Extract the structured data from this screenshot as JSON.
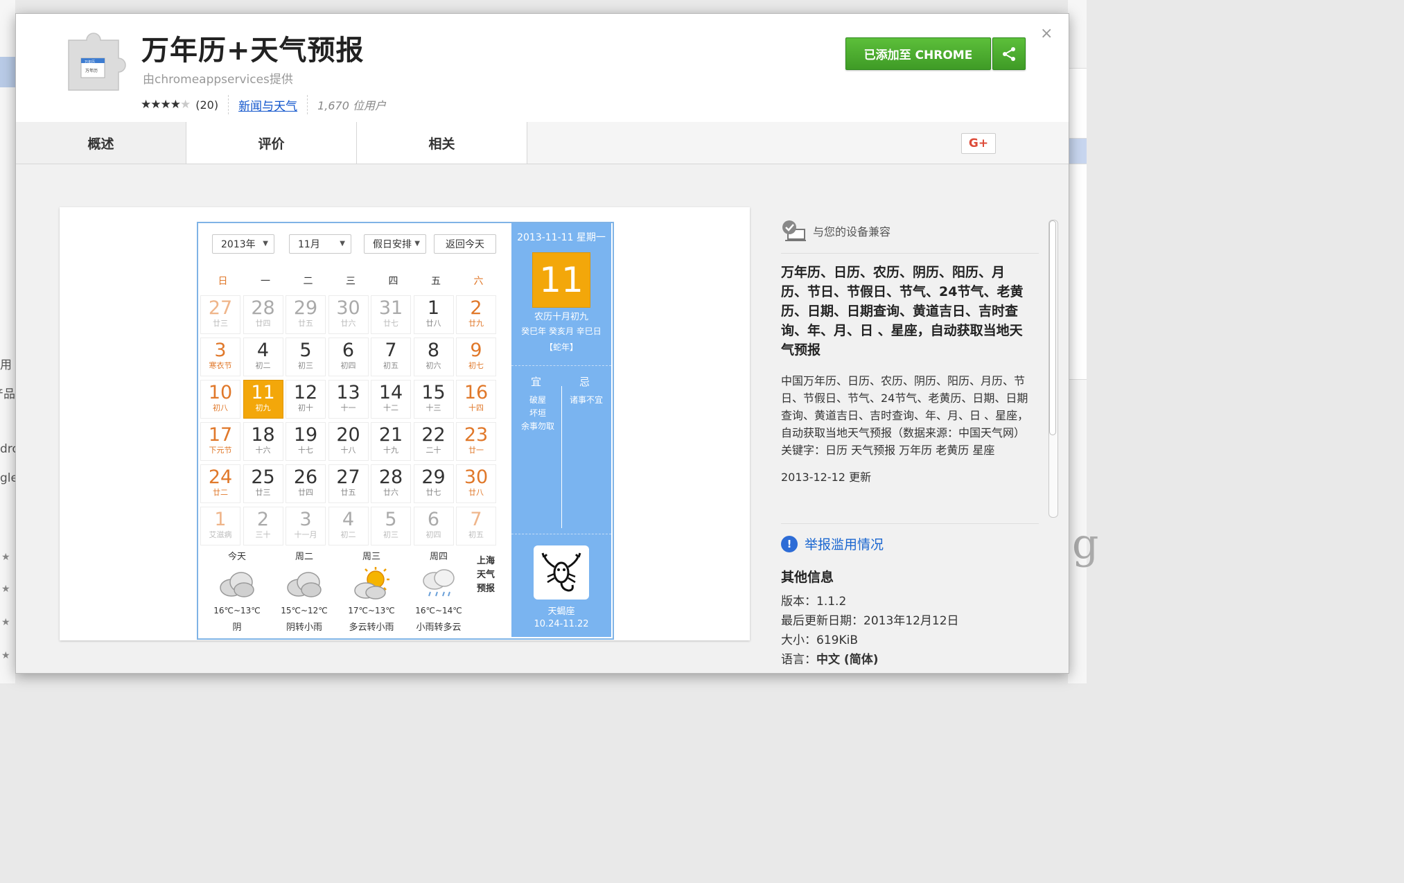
{
  "background": {
    "left_texts": [
      "用",
      "产品",
      "dro",
      "gle"
    ],
    "right_glyph": "g"
  },
  "header": {
    "icon_name": "puzzle-extension-icon",
    "icon_badge_top": "万年历",
    "icon_badge_bottom": "万年历",
    "title": "万年历+天气预报",
    "developer": "由chromeappservices提供",
    "rating": {
      "stars": 4,
      "max": 5,
      "count_label": "(20)"
    },
    "category": "新闻与天气",
    "users": "1,670 位用户",
    "add_button": "已添加至 CHROME",
    "share_icon": "share-icon",
    "close": "×"
  },
  "tabs": [
    {
      "label": "概述",
      "active": true
    },
    {
      "label": "评价",
      "active": false
    },
    {
      "label": "相关",
      "active": false
    }
  ],
  "gplus_label": "G+",
  "calendar": {
    "year_select": "2013年",
    "month_select": "11月",
    "holiday_select": "假日安排",
    "today_button": "返回今天",
    "weekdays": [
      "日",
      "一",
      "二",
      "三",
      "四",
      "五",
      "六"
    ],
    "weeks": [
      [
        [
          "27",
          "廿三"
        ],
        [
          "28",
          "廿四"
        ],
        [
          "29",
          "廿五"
        ],
        [
          "30",
          "廿六"
        ],
        [
          "31",
          "廿七"
        ],
        [
          "1",
          "廿八"
        ],
        [
          "2",
          "廿九"
        ]
      ],
      [
        [
          "3",
          "寒衣节"
        ],
        [
          "4",
          "初二"
        ],
        [
          "5",
          "初三"
        ],
        [
          "6",
          "初四"
        ],
        [
          "7",
          "初五"
        ],
        [
          "8",
          "初六"
        ],
        [
          "9",
          "初七"
        ]
      ],
      [
        [
          "10",
          "初八"
        ],
        [
          "11",
          "初九"
        ],
        [
          "12",
          "初十"
        ],
        [
          "13",
          "十一"
        ],
        [
          "14",
          "十二"
        ],
        [
          "15",
          "十三"
        ],
        [
          "16",
          "十四"
        ]
      ],
      [
        [
          "17",
          "下元节"
        ],
        [
          "18",
          "十六"
        ],
        [
          "19",
          "十七"
        ],
        [
          "20",
          "十八"
        ],
        [
          "21",
          "十九"
        ],
        [
          "22",
          "二十"
        ],
        [
          "23",
          "廿一"
        ]
      ],
      [
        [
          "24",
          "廿二"
        ],
        [
          "25",
          "廿三"
        ],
        [
          "26",
          "廿四"
        ],
        [
          "27",
          "廿五"
        ],
        [
          "28",
          "廿六"
        ],
        [
          "29",
          "廿七"
        ],
        [
          "30",
          "廿八"
        ]
      ],
      [
        [
          "1",
          "艾滋病"
        ],
        [
          "2",
          "三十"
        ],
        [
          "3",
          "十一月"
        ],
        [
          "4",
          "初二"
        ],
        [
          "5",
          "初三"
        ],
        [
          "6",
          "初四"
        ],
        [
          "7",
          "初五"
        ]
      ]
    ],
    "weather": [
      {
        "day": "今天",
        "temp": "16℃~13℃",
        "desc": "阴",
        "icon": "cloudy-icon"
      },
      {
        "day": "周二",
        "temp": "15℃~12℃",
        "desc": "阴转小雨",
        "icon": "cloudy-icon"
      },
      {
        "day": "周三",
        "temp": "17℃~13℃",
        "desc": "多云转小雨",
        "icon": "sun-cloud-icon"
      },
      {
        "day": "周四",
        "temp": "16℃~14℃",
        "desc": "小雨转多云",
        "icon": "rain-icon"
      }
    ],
    "city_label": [
      "上海",
      "天气",
      "预报"
    ],
    "side": {
      "date_line": "2013-11-11 星期一",
      "big_day": "11",
      "lunar_1": "农历十月初九",
      "lunar_2": "癸巳年 癸亥月 辛巳日",
      "lunar_3": "【蛇年】",
      "yi": "宜",
      "ji": "忌",
      "yi_items": [
        "破屋",
        "坏垣",
        "余事勿取"
      ],
      "ji_items": [
        "诸事不宜"
      ],
      "zodiac_icon": "scorpio-icon",
      "zodiac_name": "天蝎座",
      "zodiac_range": "10.24-11.22"
    }
  },
  "info": {
    "compat_text": "与您的设备兼容",
    "desc_bold": "万年历、日历、农历、阴历、阳历、月历、节日、节假日、节气、24节气、老黄历、日期、日期查询、黄道吉日、吉时查询、年、月、日 、星座，自动获取当地天气预报",
    "desc_body": [
      "中国万年历、日历、农历、阴历、阳历、月历、节日、节假日、节气、24节气、老黄历、日期、日期查询、黄道吉日、吉时查询、年、月、日 、星座，",
      "自动获取当地天气预报（数据来源：中国天气网）",
      "关键字：日历  天气预报  万年历   老黄历  星座",
      "2013-12-12 更新"
    ],
    "report": "举报滥用情况",
    "more_title": "其他信息",
    "version_label": "版本：",
    "version": "1.1.2",
    "updated_label": "最后更新日期：",
    "updated": "2013年12月12日",
    "size_label": "大小：",
    "size": "619KiB",
    "lang_label": "语言：",
    "lang": "中文 (简体)"
  }
}
